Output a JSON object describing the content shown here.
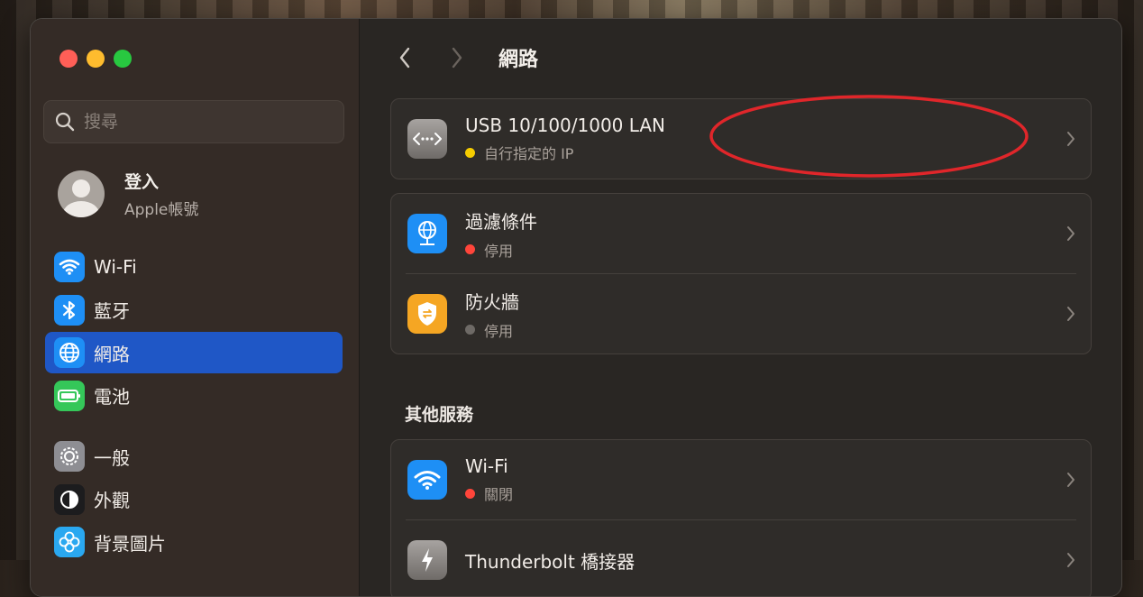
{
  "window": {
    "title": "網路"
  },
  "sidebar": {
    "search_placeholder": "搜尋",
    "account": {
      "name": "登入",
      "subtitle": "Apple帳號"
    },
    "items": [
      {
        "label": "Wi-Fi",
        "icon": "wifi-icon",
        "color": "#1e8ff5"
      },
      {
        "label": "藍牙",
        "icon": "bluetooth-icon",
        "color": "#1e8ff5"
      },
      {
        "label": "網路",
        "icon": "globe-icon",
        "color": "#1e8ff5",
        "selected": true
      },
      {
        "label": "電池",
        "icon": "battery-icon",
        "color": "#35c759"
      },
      {
        "label": "一般",
        "icon": "gear-icon",
        "color": "#8e8e93"
      },
      {
        "label": "外觀",
        "icon": "appearance-icon",
        "color": "#1c1c1e"
      },
      {
        "label": "背景圖片",
        "icon": "wallpaper-icon",
        "color": "#2aa8f0"
      }
    ]
  },
  "main": {
    "title": "網路",
    "connections": [
      {
        "title": "USB 10/100/1000 LAN",
        "status": "自行指定的 IP",
        "status_color": "#f5cc00",
        "icon": "ethernet-icon"
      }
    ],
    "security": [
      {
        "title": "過濾條件",
        "status": "停用",
        "status_color": "#ff453a",
        "icon": "filter-globe-icon"
      },
      {
        "title": "防火牆",
        "status": "停用",
        "status_color": "#6e6a66",
        "icon": "firewall-shield-icon"
      }
    ],
    "other_services_heading": "其他服務",
    "other_services": [
      {
        "title": "Wi-Fi",
        "status": "關閉",
        "status_color": "#ff453a",
        "icon": "wifi-icon"
      },
      {
        "title": "Thunderbolt 橋接器",
        "status": "",
        "status_color": "#6e6a66",
        "icon": "thunderbolt-icon"
      }
    ]
  },
  "colors": {
    "accent": "#1f57c6",
    "annotation": "#e0262a"
  }
}
